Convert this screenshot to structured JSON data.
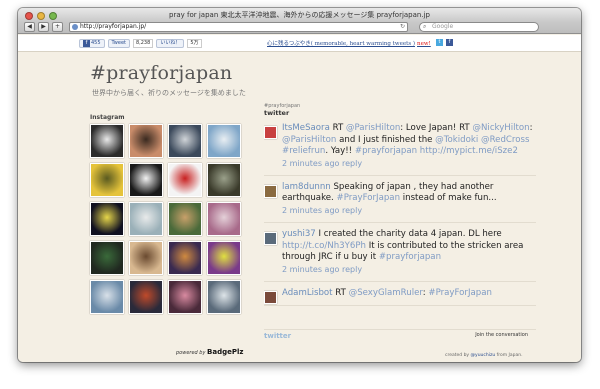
{
  "window": {
    "title": "pray for japan 東北太平洋沖地震、海外からの応援メッセージ集 prayforjapan.jp"
  },
  "browser": {
    "url": "http://prayforjapan.jp/",
    "search_placeholder": "Google",
    "back_icon": "back-arrow-icon",
    "forward_icon": "forward-arrow-icon",
    "add_label": "+"
  },
  "share_bar": {
    "facebook_count": "455",
    "tweet_label": "Tweet",
    "tweet_count": "8,238",
    "like_label": "いいね！",
    "like_count": "5万",
    "memorable_link": "心に残るつぶやき( memorable, heart warming tweets )",
    "new_badge": "new!"
  },
  "header": {
    "title": "#prayforjapan",
    "tagline": "世界中から届く、祈りのメッセージを集めました"
  },
  "instagram": {
    "label": "Instagram",
    "powered_by_prefix": "powered by",
    "powered_by_brand": "BadgePlz",
    "thumbnails": [
      {
        "colors": [
          "#2b2b2b",
          "#e9e9e9"
        ]
      },
      {
        "colors": [
          "#c98c6a",
          "#3a2a20"
        ]
      },
      {
        "colors": [
          "#3c4a5c",
          "#d0d4d8"
        ]
      },
      {
        "colors": [
          "#7fa6c8",
          "#e8eef2"
        ]
      },
      {
        "colors": [
          "#e5c33a",
          "#5a5a20"
        ]
      },
      {
        "colors": [
          "#1a1a1a",
          "#f2f2f2"
        ]
      },
      {
        "colors": [
          "#f4f4f4",
          "#c82020"
        ]
      },
      {
        "colors": [
          "#3a3a2a",
          "#9aa08a"
        ]
      },
      {
        "colors": [
          "#101020",
          "#e6d64a"
        ]
      },
      {
        "colors": [
          "#9ab0b8",
          "#e8eaea"
        ]
      },
      {
        "colors": [
          "#4a6a3a",
          "#c8a06a"
        ]
      },
      {
        "colors": [
          "#a86a8a",
          "#e4d0d8"
        ]
      },
      {
        "colors": [
          "#202820",
          "#3a6a3a"
        ]
      },
      {
        "colors": [
          "#d8b890",
          "#6a4a30"
        ]
      },
      {
        "colors": [
          "#3a2a50",
          "#d08a40"
        ]
      },
      {
        "colors": [
          "#7a3a8a",
          "#e0e040"
        ]
      },
      {
        "colors": [
          "#6a8aa8",
          "#d8e0e8"
        ]
      },
      {
        "colors": [
          "#2a2a3a",
          "#c04a2a"
        ]
      },
      {
        "colors": [
          "#4a2a3a",
          "#d88aa0"
        ]
      },
      {
        "colors": [
          "#5a6a7a",
          "#dde4e8"
        ]
      }
    ]
  },
  "twitter": {
    "small_label": "#prayforjapan",
    "heading": "twitter",
    "tweets": [
      {
        "user": "ItsMeSaora",
        "text_parts": [
          {
            "t": "RT "
          },
          {
            "u": "@ParisHilton"
          },
          {
            "t": ": Love Japan! RT "
          },
          {
            "u": "@NickyHilton"
          },
          {
            "t": ": "
          },
          {
            "u": "@ParisHilton"
          },
          {
            "t": " and I just finished the "
          },
          {
            "u": "@Tokidoki"
          },
          {
            "t": " "
          },
          {
            "u": "@RedCross"
          },
          {
            "t": " "
          },
          {
            "u": "#reliefrun"
          },
          {
            "t": ". Yay!! "
          },
          {
            "u": "#prayforjapan"
          },
          {
            "t": " "
          },
          {
            "u": "http://mypict.me/iSze2"
          }
        ],
        "time": "2 minutes ago",
        "reply": "reply",
        "avatar_color": "#c84040"
      },
      {
        "user": "lam8dunnn",
        "text_parts": [
          {
            "t": "Speaking of japan , they had another earthquake. "
          },
          {
            "u": "#PrayForJapan"
          },
          {
            "t": " instead of make fun..."
          }
        ],
        "time": "2 minutes ago",
        "reply": "reply",
        "avatar_color": "#8a6a40"
      },
      {
        "user": "yushi37",
        "text_parts": [
          {
            "t": "I created the charity data 4 japan. DL here "
          },
          {
            "u": "http://t.co/Nh3Y6Ph"
          },
          {
            "t": " It is contributed to the stricken area through JRC if u buy it "
          },
          {
            "u": "#prayforjapan"
          }
        ],
        "time": "2 minutes ago",
        "reply": "reply",
        "avatar_color": "#5a6a7a"
      },
      {
        "user": "AdamLisbot",
        "text_parts": [
          {
            "t": "RT "
          },
          {
            "u": "@SexyGlamRuler"
          },
          {
            "t": ": "
          },
          {
            "u": "#PrayForJapan"
          }
        ],
        "time": "",
        "reply": "",
        "avatar_color": "#7a4a3a"
      }
    ],
    "footer_logo": "twitter",
    "join_label": "Join the conversation"
  },
  "credit": {
    "prefix": "created by ",
    "author": "@yuuchizu",
    "suffix": " from Japan."
  }
}
